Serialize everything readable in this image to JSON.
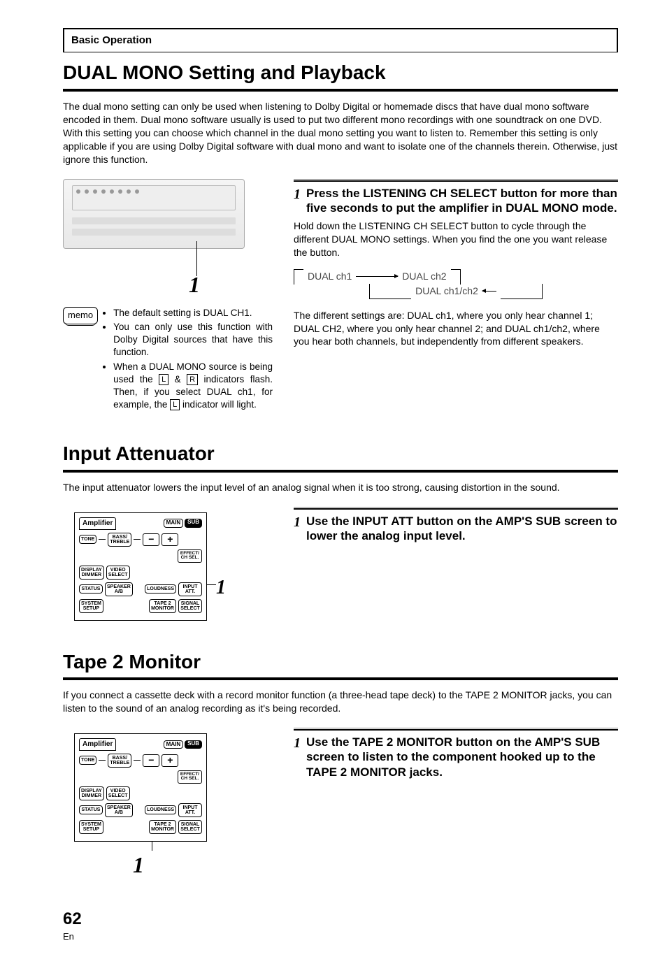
{
  "header": "Basic Operation",
  "sec1": {
    "title": "DUAL MONO Setting and Playback",
    "intro": "The dual mono setting can only be used when listening to Dolby Digital or homemade discs that have dual mono software encoded in them. Dual mono software usually is used to put two different mono recordings with one soundtrack on one DVD. With this setting you can choose which channel in the dual mono setting you want to listen to. Remember this setting is only applicable if you are using Dolby Digital software with dual mono and want to isolate one of the channels therein. Otherwise, just ignore this function.",
    "callout": "1",
    "memo_label": "memo",
    "memo": {
      "b1": "The default setting is DUAL CH1.",
      "b2": "You can only use this function with Dolby Digital sources that have this function.",
      "b3a": "When a DUAL MONO source is being used the ",
      "b3_L": "L",
      "b3_amp": " & ",
      "b3_R": "R",
      "b3b": " indicators flash. Then, if you select DUAL ch1, for example, the ",
      "b3_L2": "L",
      "b3c": " indicator will light."
    },
    "step_num": "1",
    "step_head": "Press the LISTENING CH SELECT button for more than five seconds to put the amplifier in DUAL MONO mode.",
    "step_body": "Hold down the LISTENING CH SELECT button to cycle through the different DUAL MONO settings.  When you find the one you want release the button.",
    "cycle": {
      "c1": "DUAL ch1",
      "c2": "DUAL ch2",
      "c3": "DUAL ch1/ch2"
    },
    "explain": "The different settings are: DUAL ch1, where you only hear channel 1; DUAL CH2, where you only hear channel 2; and DUAL ch1/ch2, where you hear both channels, but independently from different speakers."
  },
  "sec2": {
    "title": "Input Attenuator",
    "intro": "The input attenuator lowers the input level of an analog signal when it is too strong, causing distortion in the sound.",
    "step_num": "1",
    "step_head": "Use the INPUT ATT button on the AMP'S SUB screen to lower the analog input level.",
    "callout": "1"
  },
  "sec3": {
    "title": "Tape 2 Monitor",
    "intro": "If you connect a cassette deck with a record monitor function (a three-head tape deck) to the TAPE 2 MONITOR jacks, you can listen to the sound of an analog recording as it's being recorded.",
    "step_num": "1",
    "step_head": "Use the TAPE 2 MONITOR button on the AMP'S SUB screen to listen to the component hooked up to the TAPE 2 MONITOR jacks.",
    "callout": "1"
  },
  "remote": {
    "amp": "Amplifier",
    "main": "MAIN",
    "sub": "SUB",
    "tone": "TONE",
    "bass_treble": "BASS/\nTREBLE",
    "effect": "EFFECT/\nCH SEL.",
    "display": "DISPLAY\nDIMMER",
    "video": "VIDEO\nSELECT",
    "status": "STATUS",
    "speaker": "SPEAKER\nA/B",
    "loudness": "LOUDNESS",
    "input_att": "INPUT\nATT.",
    "system": "SYSTEM\nSETUP",
    "tape2": "TAPE 2\nMONITOR",
    "signal": "SIGNAL\nSELECT"
  },
  "footer": {
    "num": "62",
    "lang": "En"
  }
}
